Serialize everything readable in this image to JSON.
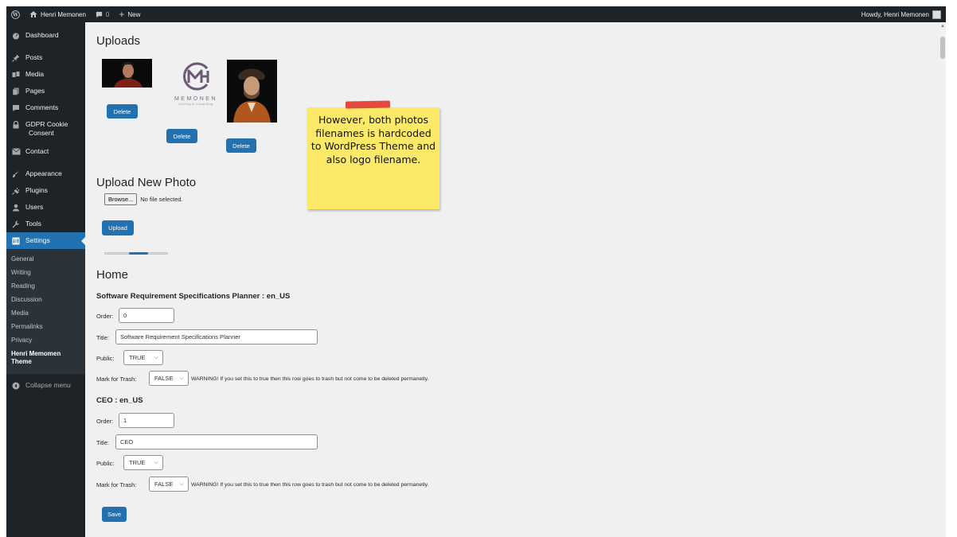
{
  "adminbar": {
    "site_name": "Henri Memonen",
    "comments_count": "0",
    "new_label": "New",
    "howdy": "Howdy, Henri Memonen"
  },
  "sidebar": {
    "items": [
      {
        "label": "Dashboard",
        "icon": "dashboard-icon"
      },
      {
        "label": "Posts",
        "icon": "pin-icon"
      },
      {
        "label": "Media",
        "icon": "media-icon"
      },
      {
        "label": "Pages",
        "icon": "pages-icon"
      },
      {
        "label": "Comments",
        "icon": "comment-icon"
      },
      {
        "label": "GDPR Cookie Consent",
        "icon": "lock-icon"
      },
      {
        "label": "Contact",
        "icon": "mail-icon"
      },
      {
        "label": "Appearance",
        "icon": "brush-icon"
      },
      {
        "label": "Plugins",
        "icon": "plugin-icon"
      },
      {
        "label": "Users",
        "icon": "users-icon"
      },
      {
        "label": "Tools",
        "icon": "wrench-icon"
      },
      {
        "label": "Settings",
        "icon": "settings-icon"
      }
    ],
    "gdpr_line1": "GDPR Cookie",
    "gdpr_line2": "Consent",
    "submenu": [
      "General",
      "Writing",
      "Reading",
      "Discussion",
      "Media",
      "Permalinks",
      "Privacy"
    ],
    "current_sub_line1": "Henri Memomen",
    "current_sub_line2": "Theme",
    "collapse": "Collapse menu"
  },
  "uploads": {
    "title": "Uploads",
    "delete_label": "Delete",
    "logo_text": "MEMONEN",
    "logo_sub": "Holding & Consulting",
    "logo_mark": "MH"
  },
  "upload_new": {
    "title": "Upload New Photo",
    "browse": "Browse...",
    "no_file": "No file selected.",
    "upload_label": "Upload"
  },
  "home": {
    "title": "Home",
    "order_label": "Order:",
    "title_label": "Title:",
    "public_label": "Public:",
    "trash_label": "Mark for Trash:",
    "warning": "WARNING! If you set this to true then this row goes to trash but not come to be deleted permanetly.",
    "rows": [
      {
        "heading": "Software Requirement Specifications Planner : en_US",
        "order": "0",
        "title": "Software Requirement Specifications Planner",
        "public": "TRUE",
        "trash": "FALSE"
      },
      {
        "heading": "CEO : en_US",
        "order": "1",
        "title": "CEO",
        "public": "TRUE",
        "trash": "FALSE"
      }
    ],
    "save_label": "Save"
  },
  "note": {
    "text": "However, both photos filenames is hardcoded to WordPress Theme and also logo filename."
  },
  "colors": {
    "admin_dark": "#1d2327",
    "accent": "#2271b1",
    "note": "#fde968",
    "tape": "#e5483d"
  }
}
